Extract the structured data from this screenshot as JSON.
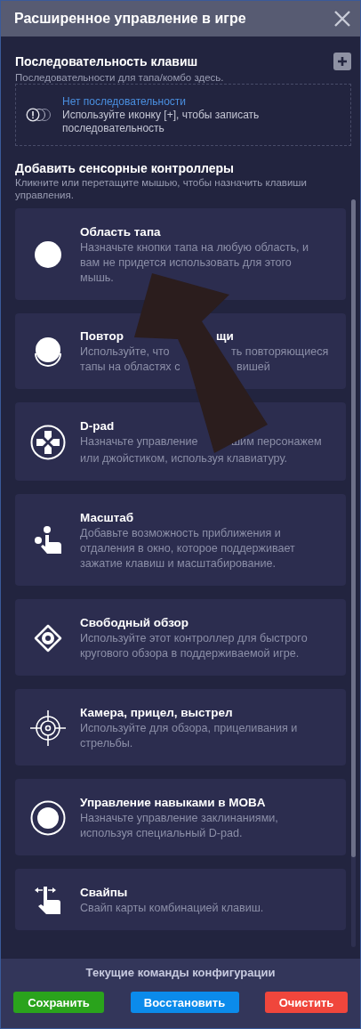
{
  "window": {
    "title": "Расширенное управление в игре"
  },
  "sequence": {
    "title": "Последовательность клавиш",
    "subtitle": "Последовательности для тапа/комбо здесь.",
    "empty_title": "Нет последовательности",
    "empty_hint": "Используйте иконку [+], чтобы записать последовательность"
  },
  "controllers": {
    "title": "Добавить сенсорные контроллеры",
    "subtitle": "Кликните или перетащите мышью, чтобы назначить клавиши управления.",
    "items": [
      {
        "kind": "tap",
        "title_parts": [
          "Область тапа"
        ],
        "description": "Назначьте кнопки тапа на любую область, и вам не придется использовать для этого мышь."
      },
      {
        "kind": "repeat",
        "title_parts": [
          "Повтор",
          "щи"
        ],
        "description_lines": [
          [
            "Используйте, что",
            "ть повторяющиеся"
          ],
          [
            "тапы на областях с",
            "вишей"
          ]
        ]
      },
      {
        "kind": "dpad",
        "title_parts": [
          "D-pad"
        ],
        "description_lines": [
          [
            "Назначьте управление",
            "шим персонажем"
          ],
          [
            "или джойстиком, используя клавиатуру."
          ]
        ]
      },
      {
        "kind": "zoom",
        "title_parts": [
          "Масштаб"
        ],
        "description": "Добавьте возможность приближения и отдаления в окно, которое поддерживает зажатие клавиш и масштабирование."
      },
      {
        "kind": "freelook",
        "title_parts": [
          "Свободный обзор"
        ],
        "description": "Используйте этот контроллер для быстрого кругового обзора в поддерживаемой игре."
      },
      {
        "kind": "crosshair",
        "title_parts": [
          "Камера, прицел, выстрел"
        ],
        "description": "Используйте для обзора, прицеливания и стрельбы."
      },
      {
        "kind": "moba",
        "title_parts": [
          "Управление навыками в MOBA"
        ],
        "description": "Назначьте управление заклинаниями, используя специальный D-pad."
      },
      {
        "kind": "swipe",
        "title_parts": [
          "Свайпы"
        ],
        "description": "Свайп карты комбинацией клавиш."
      }
    ]
  },
  "footer": {
    "title": "Текущие команды конфигурации",
    "buttons": [
      {
        "label": "Сохранить",
        "kind": "save"
      },
      {
        "label": "Восстановить",
        "kind": "restore"
      },
      {
        "label": "Очистить",
        "kind": "clear"
      }
    ]
  }
}
